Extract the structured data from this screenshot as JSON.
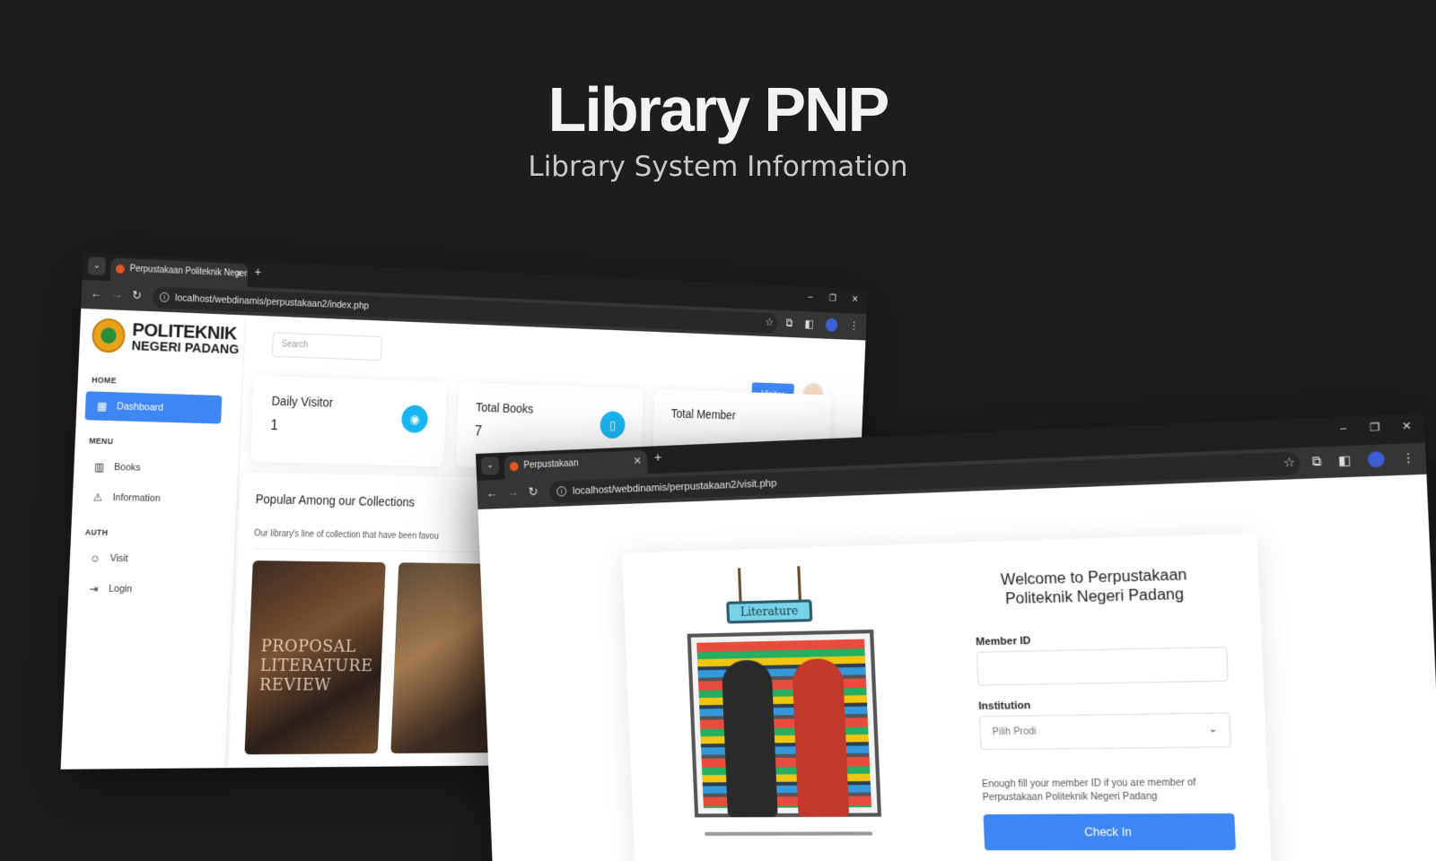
{
  "hero": {
    "title": "Library PNP",
    "subtitle": "Library System Information"
  },
  "window1": {
    "tab_title": "Perpustakaan Politeknik Negeri",
    "url": "localhost/webdinamis/perpustakaan2/index.php",
    "logo": {
      "line1": "POLITEKNIK",
      "line2": "NEGERI PADANG"
    },
    "sidebar": {
      "sections": [
        {
          "title": "HOME",
          "items": [
            {
              "label": "Dashboard",
              "icon": "dashboard-icon",
              "active": true
            }
          ]
        },
        {
          "title": "MENU",
          "items": [
            {
              "label": "Books",
              "icon": "books-icon"
            },
            {
              "label": "Information",
              "icon": "warning-icon"
            }
          ]
        },
        {
          "title": "AUTH",
          "items": [
            {
              "label": "Visit",
              "icon": "smile-icon"
            },
            {
              "label": "Login",
              "icon": "login-icon"
            }
          ]
        }
      ]
    },
    "search_placeholder": "Search",
    "visitor_button": "Visitor",
    "cards": [
      {
        "title": "Daily Visitor",
        "value": "1",
        "icon": "eye-icon"
      },
      {
        "title": "Total Books",
        "value": "7",
        "icon": "book-icon"
      },
      {
        "title": "Total Member",
        "value": "",
        "icon": ""
      }
    ],
    "popular": {
      "title": "Popular Among our Collections",
      "description": "Our library's line of collection that have been favou",
      "books": [
        {
          "cover_text": "PROPOSAL LITERATURE REVIEW"
        },
        {
          "cover_text": ""
        }
      ]
    }
  },
  "window2": {
    "tab_title": "Perpustakaan",
    "url": "localhost/webdinamis/perpustakaan2/visit.php",
    "illustration_sign": "Literature",
    "welcome": "Welcome to Perpustakaan Politeknik Negeri Padang",
    "member_id_label": "Member ID",
    "member_id_value": "",
    "institution_label": "Institution",
    "institution_selected": "Pilih Prodi",
    "hint": "Enough fill your member ID if you are member of Perpustakaan Politeknik Negeri Padang",
    "checkin_button": "Check In"
  },
  "colors": {
    "accent": "#3f86f5",
    "card_icon": "#19b5f0",
    "background": "#1d1d1d"
  }
}
